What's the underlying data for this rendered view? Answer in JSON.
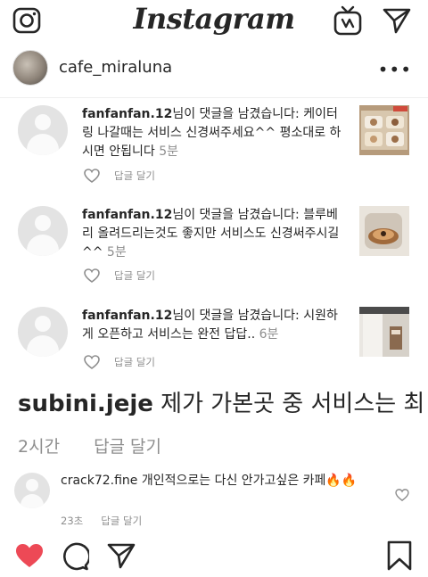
{
  "app": {
    "logo_text": "Instagram"
  },
  "header": {
    "username": "cafe_miraluna",
    "more": "•••"
  },
  "comments": [
    {
      "user": "fanfanfan.12",
      "text": "님이 댓글을 남겼습니다: 케이터링 나갈때는 서비스 신경써주세요^^ 평소대로 하시면 안됩니다",
      "time": "5분",
      "reply": "답글 달기"
    },
    {
      "user": "fanfanfan.12",
      "text": "님이 댓글을 남겼습니다: 블루베리 올려드리는것도 좋지만 서비스도 신경써주시길^^",
      "time": "5분",
      "reply": "답글 달기"
    },
    {
      "user": "fanfanfan.12",
      "text": "님이 댓글을 남겼습니다: 시원하게 오픈하고 서비스는 완전 답답..",
      "time": "6분",
      "reply": "답글 달기"
    }
  ],
  "big_comment": {
    "user": "subini.jeje",
    "text": " 제가 가본곳 중 서비스는 최",
    "time": "2시간",
    "reply": "답글 달기"
  },
  "last_comment": {
    "user": "crack72.fine",
    "text": " 개인적으로는 다신 안가고싶은 카페🔥🔥",
    "time": "23초",
    "reply": "답글 달기"
  },
  "colors": {
    "like_red": "#ed4956",
    "secondary_text": "#8e8e8e",
    "primary_text": "#262626"
  },
  "icons": [
    "camera-icon",
    "igtv-icon",
    "direct-message-icon",
    "more-icon",
    "heart-icon",
    "comment-icon",
    "share-icon",
    "bookmark-icon"
  ]
}
